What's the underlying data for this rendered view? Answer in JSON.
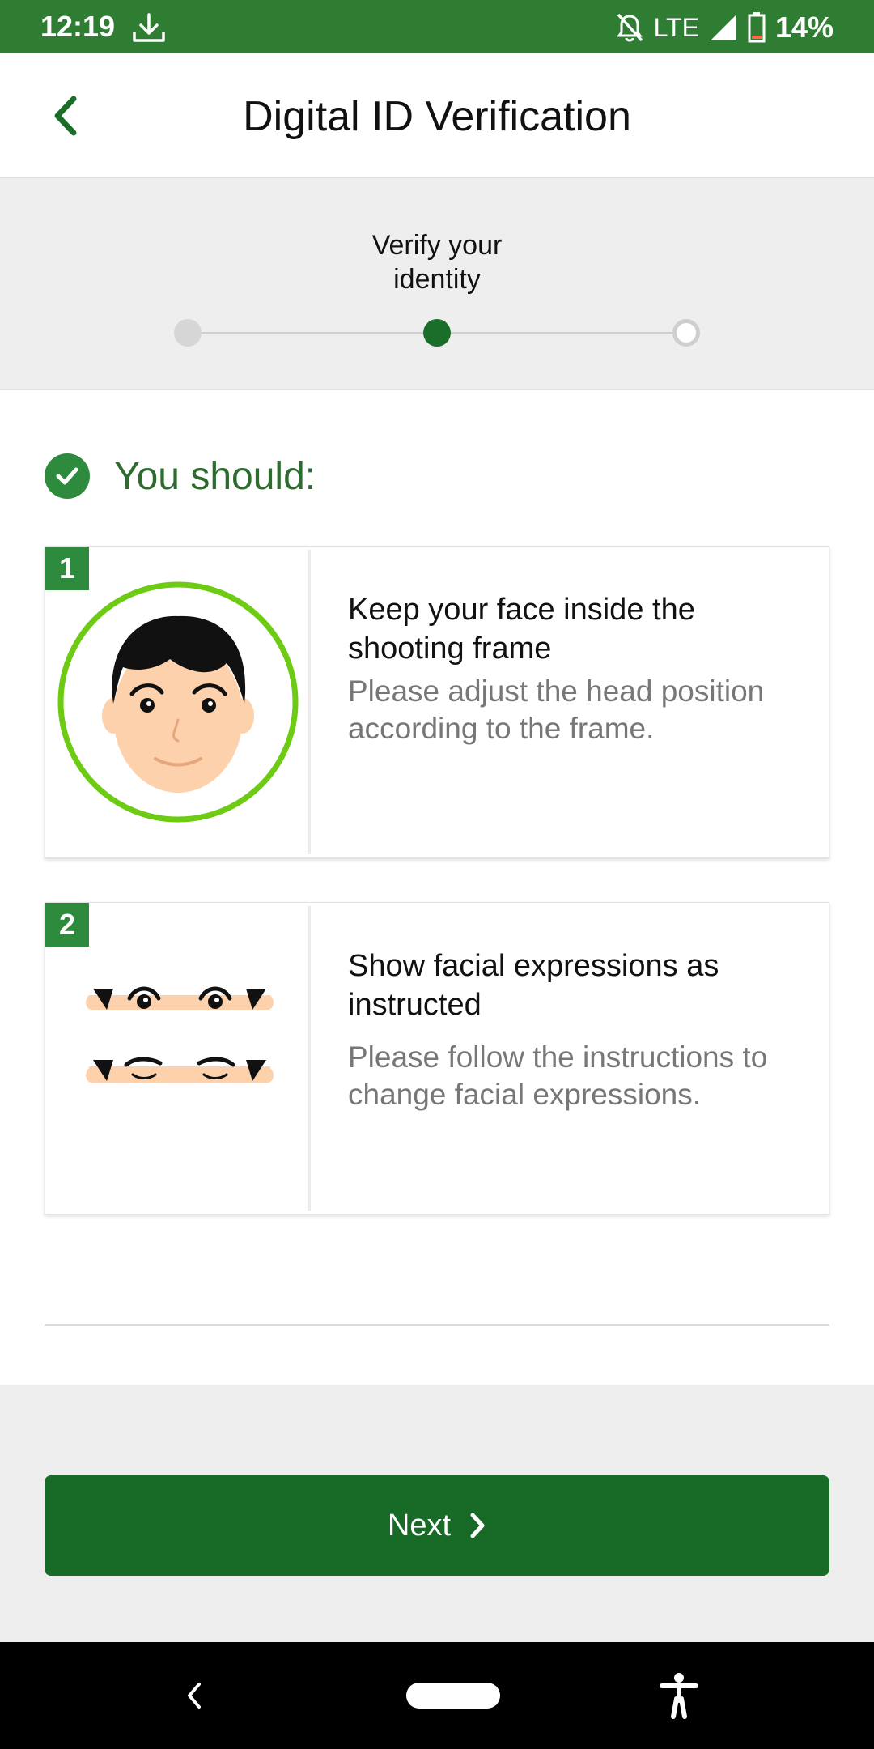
{
  "status_bar": {
    "time": "12:19",
    "network": "LTE",
    "battery": "14%",
    "icons": [
      "download-icon",
      "notifications-off-icon",
      "signal-icon",
      "battery-icon"
    ]
  },
  "header": {
    "title": "Digital ID Verification",
    "back_icon": "chevron-left-icon"
  },
  "stepper": {
    "current_label": "Verify your\nidentity",
    "steps_total": 3,
    "current_step": 2
  },
  "section": {
    "heading": "You should:",
    "icon": "check-circle-icon"
  },
  "cards": [
    {
      "number": "1",
      "title": "Keep your face inside the shooting frame",
      "description": "Please adjust the head position according to the frame.",
      "illustration": "face-in-frame-illustration"
    },
    {
      "number": "2",
      "title": "Show facial expressions as instructed",
      "description": "Please follow the instructions to change facial expressions.",
      "illustration": "facial-expressions-illustration"
    }
  ],
  "next_button": {
    "label": "Next",
    "icon": "chevron-right-icon"
  },
  "colors": {
    "status_bar": "#2e7d32",
    "primary": "#176b27",
    "accent": "#2e8b3e",
    "frame_ring": "#66cc11"
  }
}
